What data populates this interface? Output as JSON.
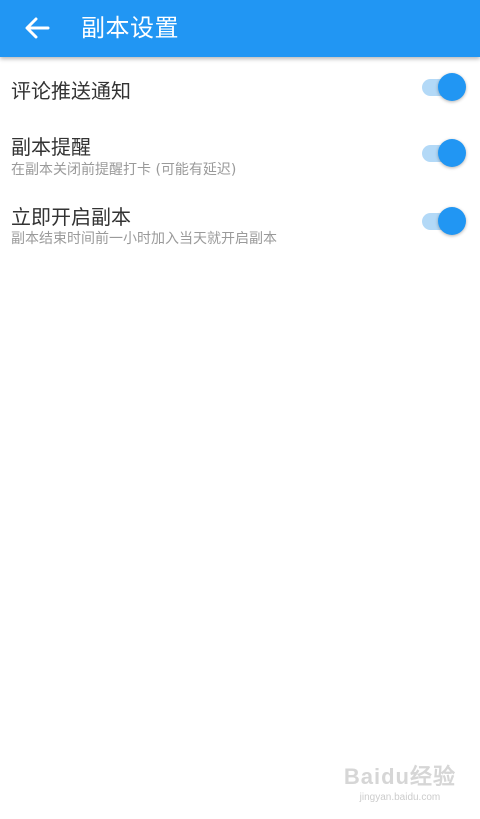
{
  "header": {
    "back_icon": "arrow-left-icon",
    "title": "副本设置",
    "accent_color": "#2196f3"
  },
  "settings": [
    {
      "title": "评论推送通知",
      "subtitle": "",
      "enabled": true
    },
    {
      "title": "副本提醒",
      "subtitle": "在副本关闭前提醒打卡 (可能有延迟)",
      "enabled": true
    },
    {
      "title": "立即开启副本",
      "subtitle": "副本结束时间前一小时加入当天就开启副本",
      "enabled": true
    }
  ],
  "watermark": {
    "logo": "Baidu经验",
    "url": "jingyan.baidu.com"
  }
}
